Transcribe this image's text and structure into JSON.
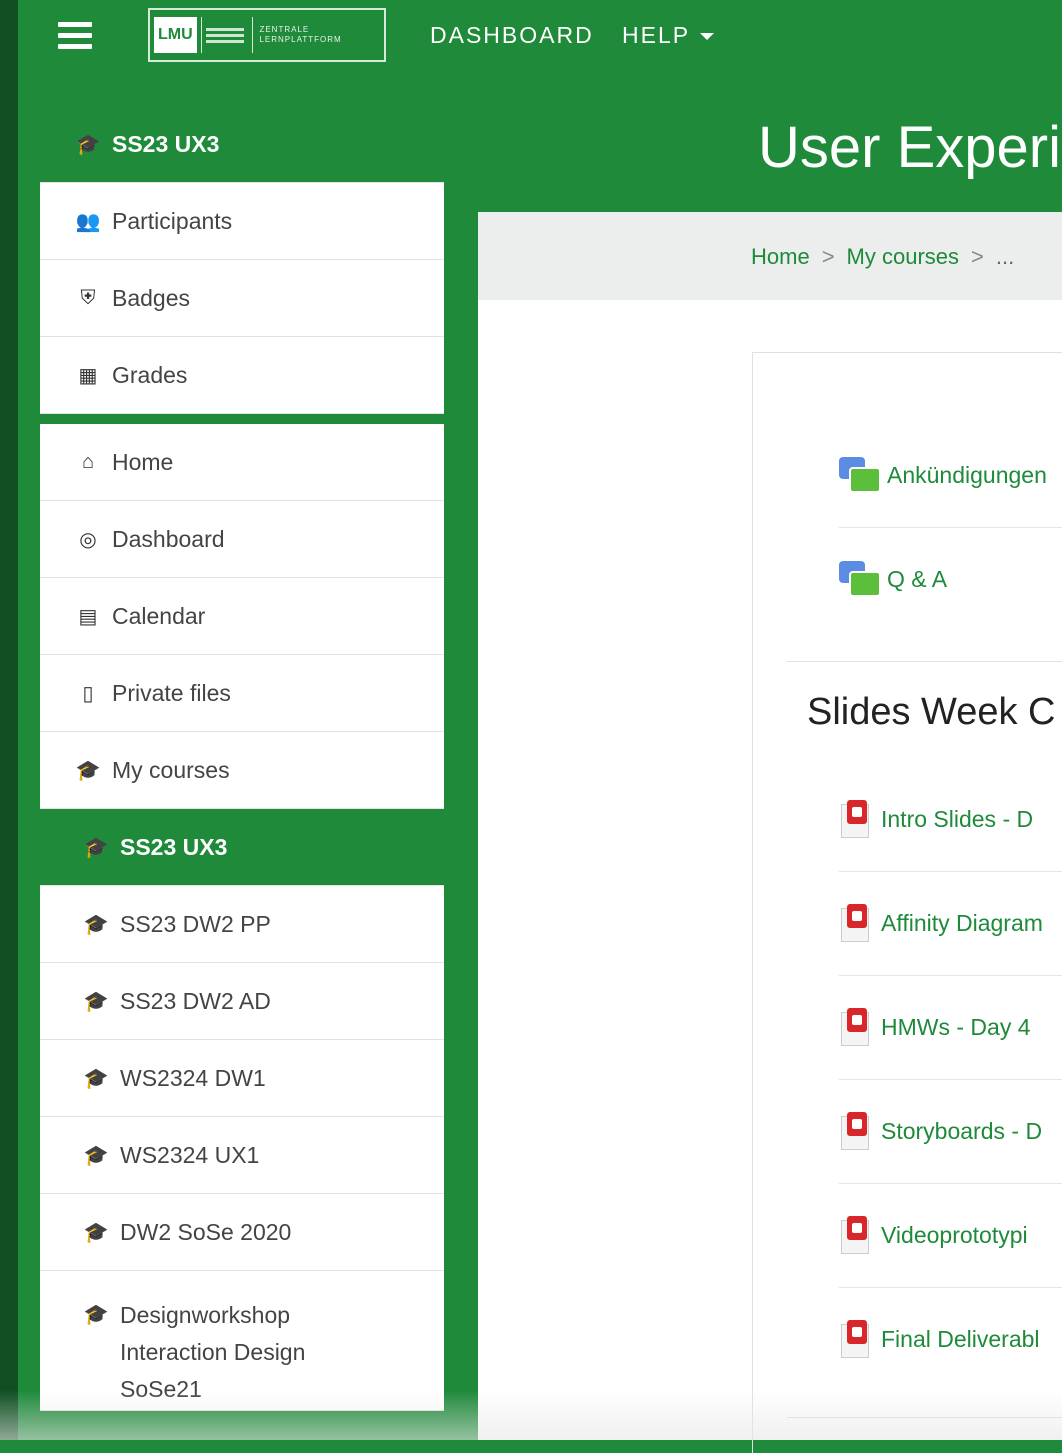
{
  "navbar": {
    "logo_text": "LMU",
    "logo_subtext": "ZENTRALE LERNPLATTFORM",
    "dashboard_label": "DASHBOARD",
    "help_label": "HELP"
  },
  "sidebar": {
    "course_block": [
      {
        "label": "SS23 UX3",
        "icon": "graduation-cap-icon",
        "active": true
      },
      {
        "label": "Participants",
        "icon": "users-icon"
      },
      {
        "label": "Badges",
        "icon": "shield-icon"
      },
      {
        "label": "Grades",
        "icon": "table-icon"
      }
    ],
    "nav_block": [
      {
        "label": "Home",
        "icon": "home-icon"
      },
      {
        "label": "Dashboard",
        "icon": "dashboard-icon"
      },
      {
        "label": "Calendar",
        "icon": "calendar-icon"
      },
      {
        "label": "Private files",
        "icon": "file-icon"
      },
      {
        "label": "My courses",
        "icon": "graduation-cap-icon"
      },
      {
        "label": "SS23 UX3",
        "icon": "graduation-cap-icon",
        "active": true
      },
      {
        "label": "SS23 DW2 PP",
        "icon": "graduation-cap-icon"
      },
      {
        "label": "SS23 DW2 AD",
        "icon": "graduation-cap-icon"
      },
      {
        "label": "WS2324 DW1",
        "icon": "graduation-cap-icon"
      },
      {
        "label": "WS2324 UX1",
        "icon": "graduation-cap-icon"
      },
      {
        "label": "DW2 SoSe 2020",
        "icon": "graduation-cap-icon"
      },
      {
        "label": "Designworkshop Interaction Design SoSe21",
        "icon": "graduation-cap-icon"
      }
    ]
  },
  "main": {
    "course_title": "User Experie",
    "breadcrumb": [
      "Home",
      "My courses",
      "..."
    ],
    "forums": [
      "Ankündigungen",
      "Q & A"
    ],
    "section_title": "Slides Week C",
    "resources": [
      "Intro Slides - D",
      "Affinity Diagram",
      "HMWs - Day 4",
      "Storyboards - D",
      "Videoprototypi",
      "Final Deliverabl"
    ]
  },
  "colors": {
    "brand_green": "#1e8a3a",
    "breadcrumb_bg": "#eceeed"
  }
}
